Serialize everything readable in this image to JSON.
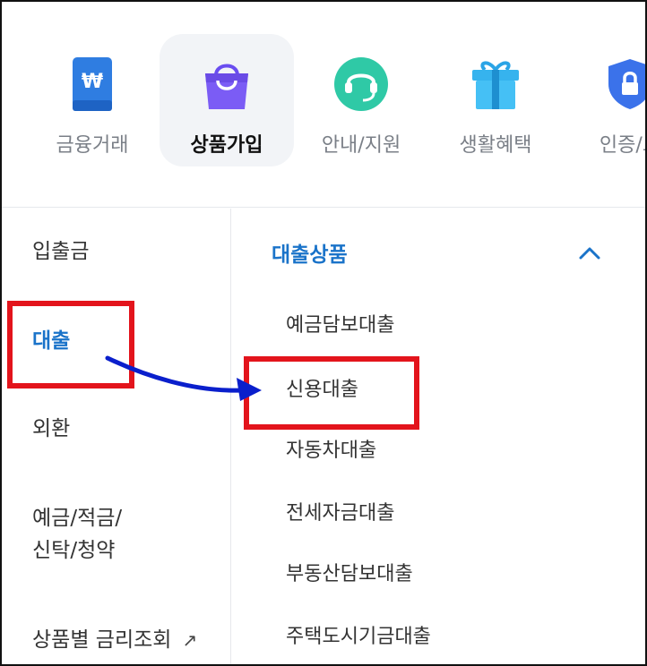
{
  "top_categories": [
    {
      "label": "금융거래",
      "icon": "wallet-won-icon"
    },
    {
      "label": "상품가입",
      "icon": "shopping-bag-icon",
      "selected": true
    },
    {
      "label": "안내/지원",
      "icon": "headset-icon"
    },
    {
      "label": "생활혜택",
      "icon": "gift-icon"
    },
    {
      "label": "인증/보",
      "icon": "shield-lock-icon"
    }
  ],
  "left_menu": {
    "items": [
      "입출금",
      "대출",
      "외환",
      "예금/적금/",
      "신탁/청약",
      "상품별 금리조회"
    ],
    "active": "대출",
    "external_icon": "↗"
  },
  "submenu": {
    "header": "대출상품",
    "items": [
      "예금담보대출",
      "신용대출",
      "자동차대출",
      "전세자금대출",
      "부동산담보대출",
      "주택도시기금대출"
    ]
  },
  "icon_glyphs": {
    "won": "₩"
  },
  "colors": {
    "accent": "#1a73c9",
    "highlight": "#e3141c",
    "arrow": "#0a1fcc",
    "selected_bg": "#f2f4f7"
  }
}
